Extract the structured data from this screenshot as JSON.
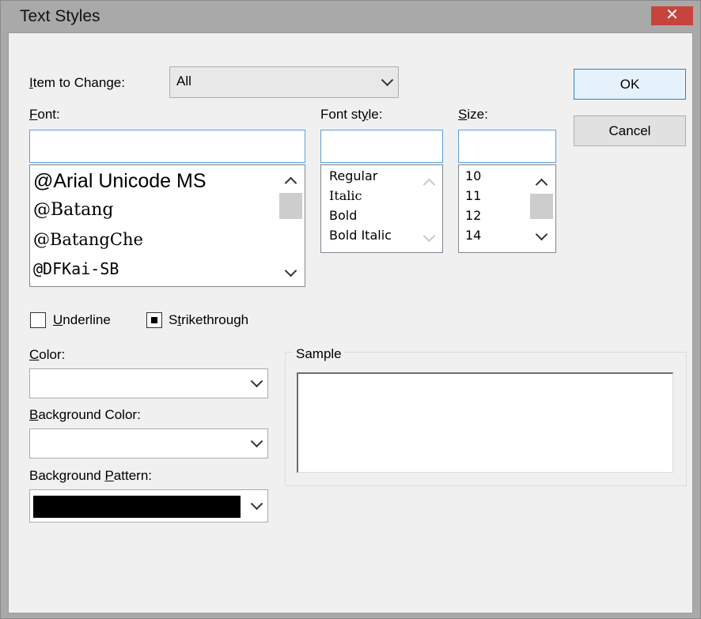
{
  "window": {
    "title": "Text Styles",
    "close_glyph": "✕"
  },
  "item_to_change": {
    "label": "Item to Change:",
    "value": "All"
  },
  "font": {
    "label": "Font:",
    "value": "",
    "items": [
      "@Arial Unicode MS",
      "@Batang",
      "@BatangChe",
      "@DFKai-SB"
    ]
  },
  "font_style": {
    "label": "Font style:",
    "value": "",
    "items": [
      "Regular",
      "Italic",
      "Bold",
      "Bold Italic"
    ]
  },
  "size": {
    "label": "Size:",
    "value": "",
    "items": [
      "10",
      "11",
      "12",
      "14"
    ]
  },
  "buttons": {
    "ok": "OK",
    "cancel": "Cancel"
  },
  "checks": {
    "underline": "Underline",
    "underline_checked": false,
    "strikethrough": "Strikethrough",
    "strikethrough_checked": true
  },
  "color": {
    "label": "Color:",
    "value": ""
  },
  "background_color": {
    "label": "Background Color:",
    "value": ""
  },
  "background_pattern": {
    "label": "Background Pattern:",
    "swatch_color": "#000000"
  },
  "sample": {
    "label": "Sample"
  }
}
